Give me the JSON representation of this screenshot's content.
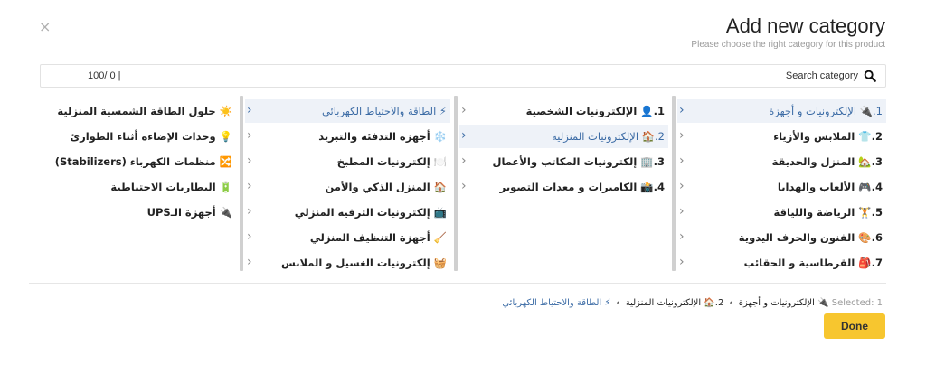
{
  "header": {
    "title": "Add new category",
    "subtitle": "Please choose the right category for this product",
    "close_label": "×"
  },
  "search": {
    "counter": "100/ 0 |",
    "placeholder": "Search category",
    "value": ""
  },
  "columns": [
    {
      "items": [
        {
          "label": "1.🔌 الإلكترونيات و أجهزة",
          "selected": true
        },
        {
          "label": "2.👕 الملابس والأزياء",
          "selected": false
        },
        {
          "label": "3.🏡 المنزل والحديقة",
          "selected": false
        },
        {
          "label": "4.🎮 الألعاب والهدايا",
          "selected": false
        },
        {
          "label": "5.🏋️ الرياضة واللياقة",
          "selected": false
        },
        {
          "label": "6.🎨 الفنون والحرف اليدوية",
          "selected": false
        },
        {
          "label": "7.🎒 القرطاسية و الحقائب",
          "selected": false
        }
      ]
    },
    {
      "items": [
        {
          "label": "1.👤 الإلكترونيات الشخصية",
          "selected": false
        },
        {
          "label": "2.🏠 الإلكترونيات المنزلية",
          "selected": true
        },
        {
          "label": "3.🏢 إلكترونيات المكاتب والأعمال",
          "selected": false
        },
        {
          "label": "4.📸 الكاميرات و معدات التصوير",
          "selected": false
        }
      ]
    },
    {
      "items": [
        {
          "label": "⚡ الطاقة والاحتياط الكهربائي",
          "selected": true
        },
        {
          "label": "❄️ أجهزة التدفئة والتبريد",
          "selected": false
        },
        {
          "label": "🍽️ إلكترونيات المطبخ",
          "selected": false
        },
        {
          "label": "🏠 المنزل الذكي والأمن",
          "selected": false
        },
        {
          "label": "📺 إلكترونيات الترفيه المنزلي",
          "selected": false
        },
        {
          "label": "🧹 أجهزة التنظيف المنزلي",
          "selected": false
        },
        {
          "label": "🧺 إلكترونيات الغسيل و الملابس",
          "selected": false
        }
      ]
    },
    {
      "items": [
        {
          "label": "☀️ حلول الطاقة الشمسية المنزلية",
          "selected": false
        },
        {
          "label": "💡 وحدات الإضاءة أثناء الطوارئ",
          "selected": false
        },
        {
          "label": "🔀 منظمات الكهرباء (Stabilizers)",
          "selected": false
        },
        {
          "label": "🔋 البطاريات الاحتياطية",
          "selected": false
        },
        {
          "label": "🔌 أجهزة الـUPS",
          "selected": false
        }
      ]
    }
  ],
  "chevron": "‹",
  "breadcrumb": {
    "prefix": "Selected: 1",
    "separator": "›",
    "items": [
      "🔌 الإلكترونيات و أجهزة",
      "2.🏠 الإلكترونيات المنزلية",
      "⚡ الطاقة والاحتياط الكهربائي"
    ]
  },
  "footer": {
    "done_label": "Done"
  },
  "colors": {
    "accent": "#3b6ba5",
    "done_button": "#f7c62f",
    "selected_bg": "#eef2f8"
  }
}
